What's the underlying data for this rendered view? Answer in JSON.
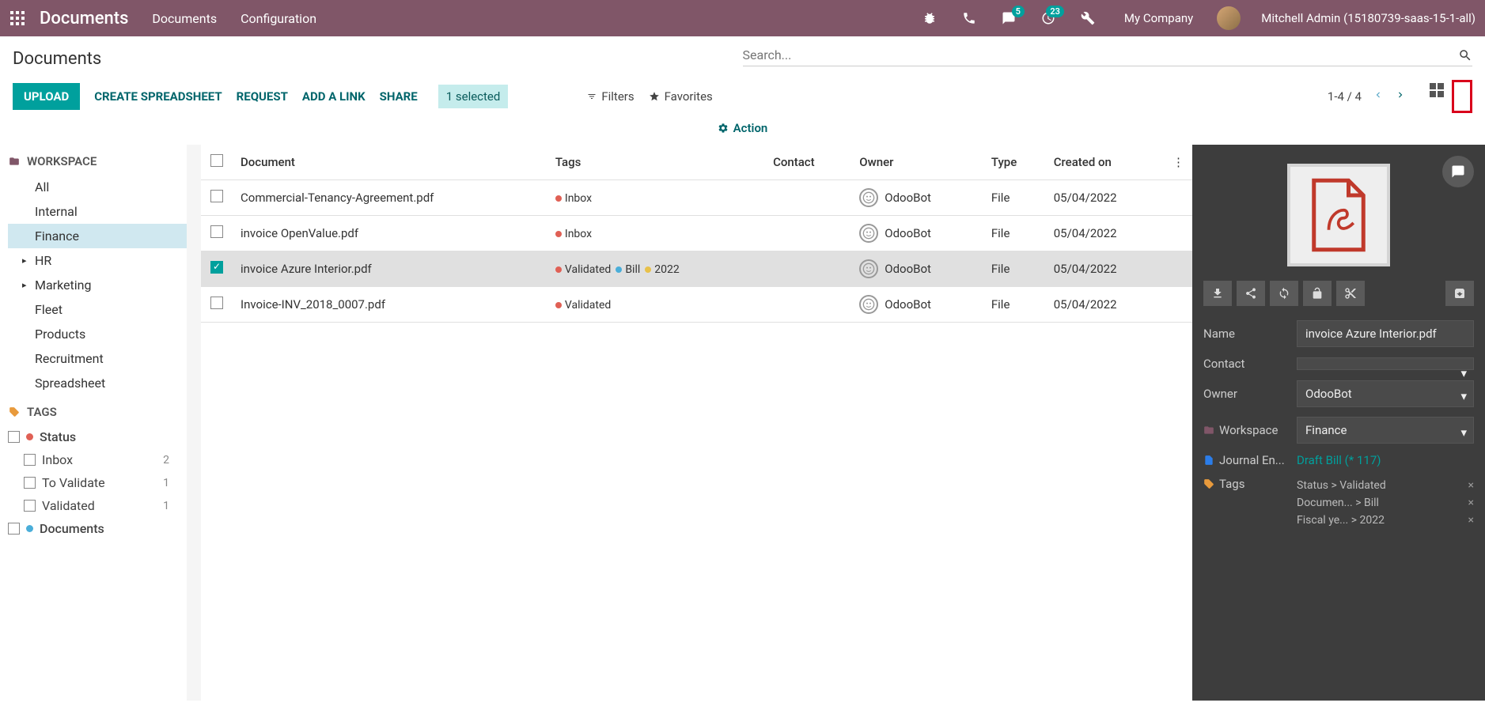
{
  "topnav": {
    "app_title": "Documents",
    "links": [
      "Documents",
      "Configuration"
    ],
    "messages_badge": "5",
    "activities_badge": "23",
    "company": "My Company",
    "username": "Mitchell Admin (15180739-saas-15-1-all)"
  },
  "control": {
    "breadcrumb": "Documents",
    "search_placeholder": "Search...",
    "buttons": {
      "upload": "UPLOAD",
      "create_spreadsheet": "CREATE SPREADSHEET",
      "request": "REQUEST",
      "add_link": "ADD A LINK",
      "share": "SHARE"
    },
    "selected_label": "1 selected",
    "filters_label": "Filters",
    "favorites_label": "Favorites",
    "action_label": "Action",
    "pager": "1-4 / 4"
  },
  "sidebar": {
    "workspace_header": "WORKSPACE",
    "workspaces": [
      {
        "label": "All",
        "expandable": false,
        "active": false
      },
      {
        "label": "Internal",
        "expandable": false,
        "active": false
      },
      {
        "label": "Finance",
        "expandable": false,
        "active": true
      },
      {
        "label": "HR",
        "expandable": true,
        "active": false
      },
      {
        "label": "Marketing",
        "expandable": true,
        "active": false
      },
      {
        "label": "Fleet",
        "expandable": false,
        "active": false
      },
      {
        "label": "Products",
        "expandable": false,
        "active": false
      },
      {
        "label": "Recruitment",
        "expandable": false,
        "active": false
      },
      {
        "label": "Spreadsheet",
        "expandable": false,
        "active": false
      }
    ],
    "tags_header": "TAGS",
    "tag_groups": [
      {
        "label": "Status",
        "color": "#e06055",
        "items": [
          {
            "label": "Inbox",
            "count": "2"
          },
          {
            "label": "To Validate",
            "count": "1"
          },
          {
            "label": "Validated",
            "count": "1"
          }
        ]
      },
      {
        "label": "Documents",
        "color": "#4aaed9",
        "items": []
      }
    ]
  },
  "table": {
    "columns": [
      "Document",
      "Tags",
      "Contact",
      "Owner",
      "Type",
      "Created on"
    ],
    "rows": [
      {
        "selected": false,
        "doc": "Commercial-Tenancy-Agreement.pdf",
        "tags": [
          {
            "color": "#e06055",
            "text": "Inbox"
          }
        ],
        "contact": "",
        "owner": "OdooBot",
        "type": "File",
        "created": "05/04/2022"
      },
      {
        "selected": false,
        "doc": "invoice OpenValue.pdf",
        "tags": [
          {
            "color": "#e06055",
            "text": "Inbox"
          }
        ],
        "contact": "",
        "owner": "OdooBot",
        "type": "File",
        "created": "05/04/2022"
      },
      {
        "selected": true,
        "doc": "invoice Azure Interior.pdf",
        "tags": [
          {
            "color": "#e06055",
            "text": "Validated"
          },
          {
            "color": "#4aaed9",
            "text": "Bill"
          },
          {
            "color": "#e8c14a",
            "text": "2022"
          }
        ],
        "contact": "",
        "owner": "OdooBot",
        "type": "File",
        "created": "05/04/2022"
      },
      {
        "selected": false,
        "doc": "Invoice-INV_2018_0007.pdf",
        "tags": [
          {
            "color": "#e06055",
            "text": "Validated"
          }
        ],
        "contact": "",
        "owner": "OdooBot",
        "type": "File",
        "created": "05/04/2022"
      }
    ]
  },
  "detail": {
    "fields": {
      "name_label": "Name",
      "name_value": "invoice Azure Interior.pdf",
      "contact_label": "Contact",
      "contact_value": "",
      "owner_label": "Owner",
      "owner_value": "OdooBot",
      "workspace_label": "Workspace",
      "workspace_value": "Finance",
      "journal_label": "Journal En...",
      "journal_value": "Draft Bill (* 117)",
      "tags_label": "Tags"
    },
    "tags": [
      {
        "group": "Status",
        "value": "Validated"
      },
      {
        "group": "Documen...",
        "value": "Bill"
      },
      {
        "group": "Fiscal ye...",
        "value": "2022"
      }
    ]
  },
  "colors": {
    "accent": "#00a09d",
    "tag_red": "#e06055",
    "tag_blue": "#4aaed9",
    "tag_yellow": "#e8c14a",
    "folder": "#805668"
  }
}
